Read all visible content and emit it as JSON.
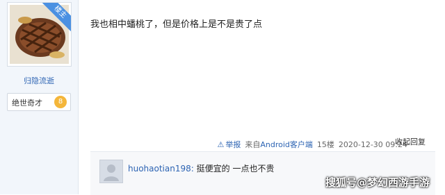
{
  "author": {
    "owner_badge": "楼主",
    "username": "归隐流逝",
    "title": "绝世奇才",
    "level": "8"
  },
  "post": {
    "text": "我也相中蟠桃了，但是价格上是不是贵了点"
  },
  "meta": {
    "report": "举报",
    "source_prefix": "来自",
    "client": "Android客户端",
    "floor": "15楼",
    "timestamp": "2020-12-30 09:24",
    "collapse_reply": "收起回复"
  },
  "reply": {
    "user": "huohaotian198:",
    "text": "挺便宜的 一点也不贵"
  },
  "watermark": "搜狐号@梦幻西游手游"
}
